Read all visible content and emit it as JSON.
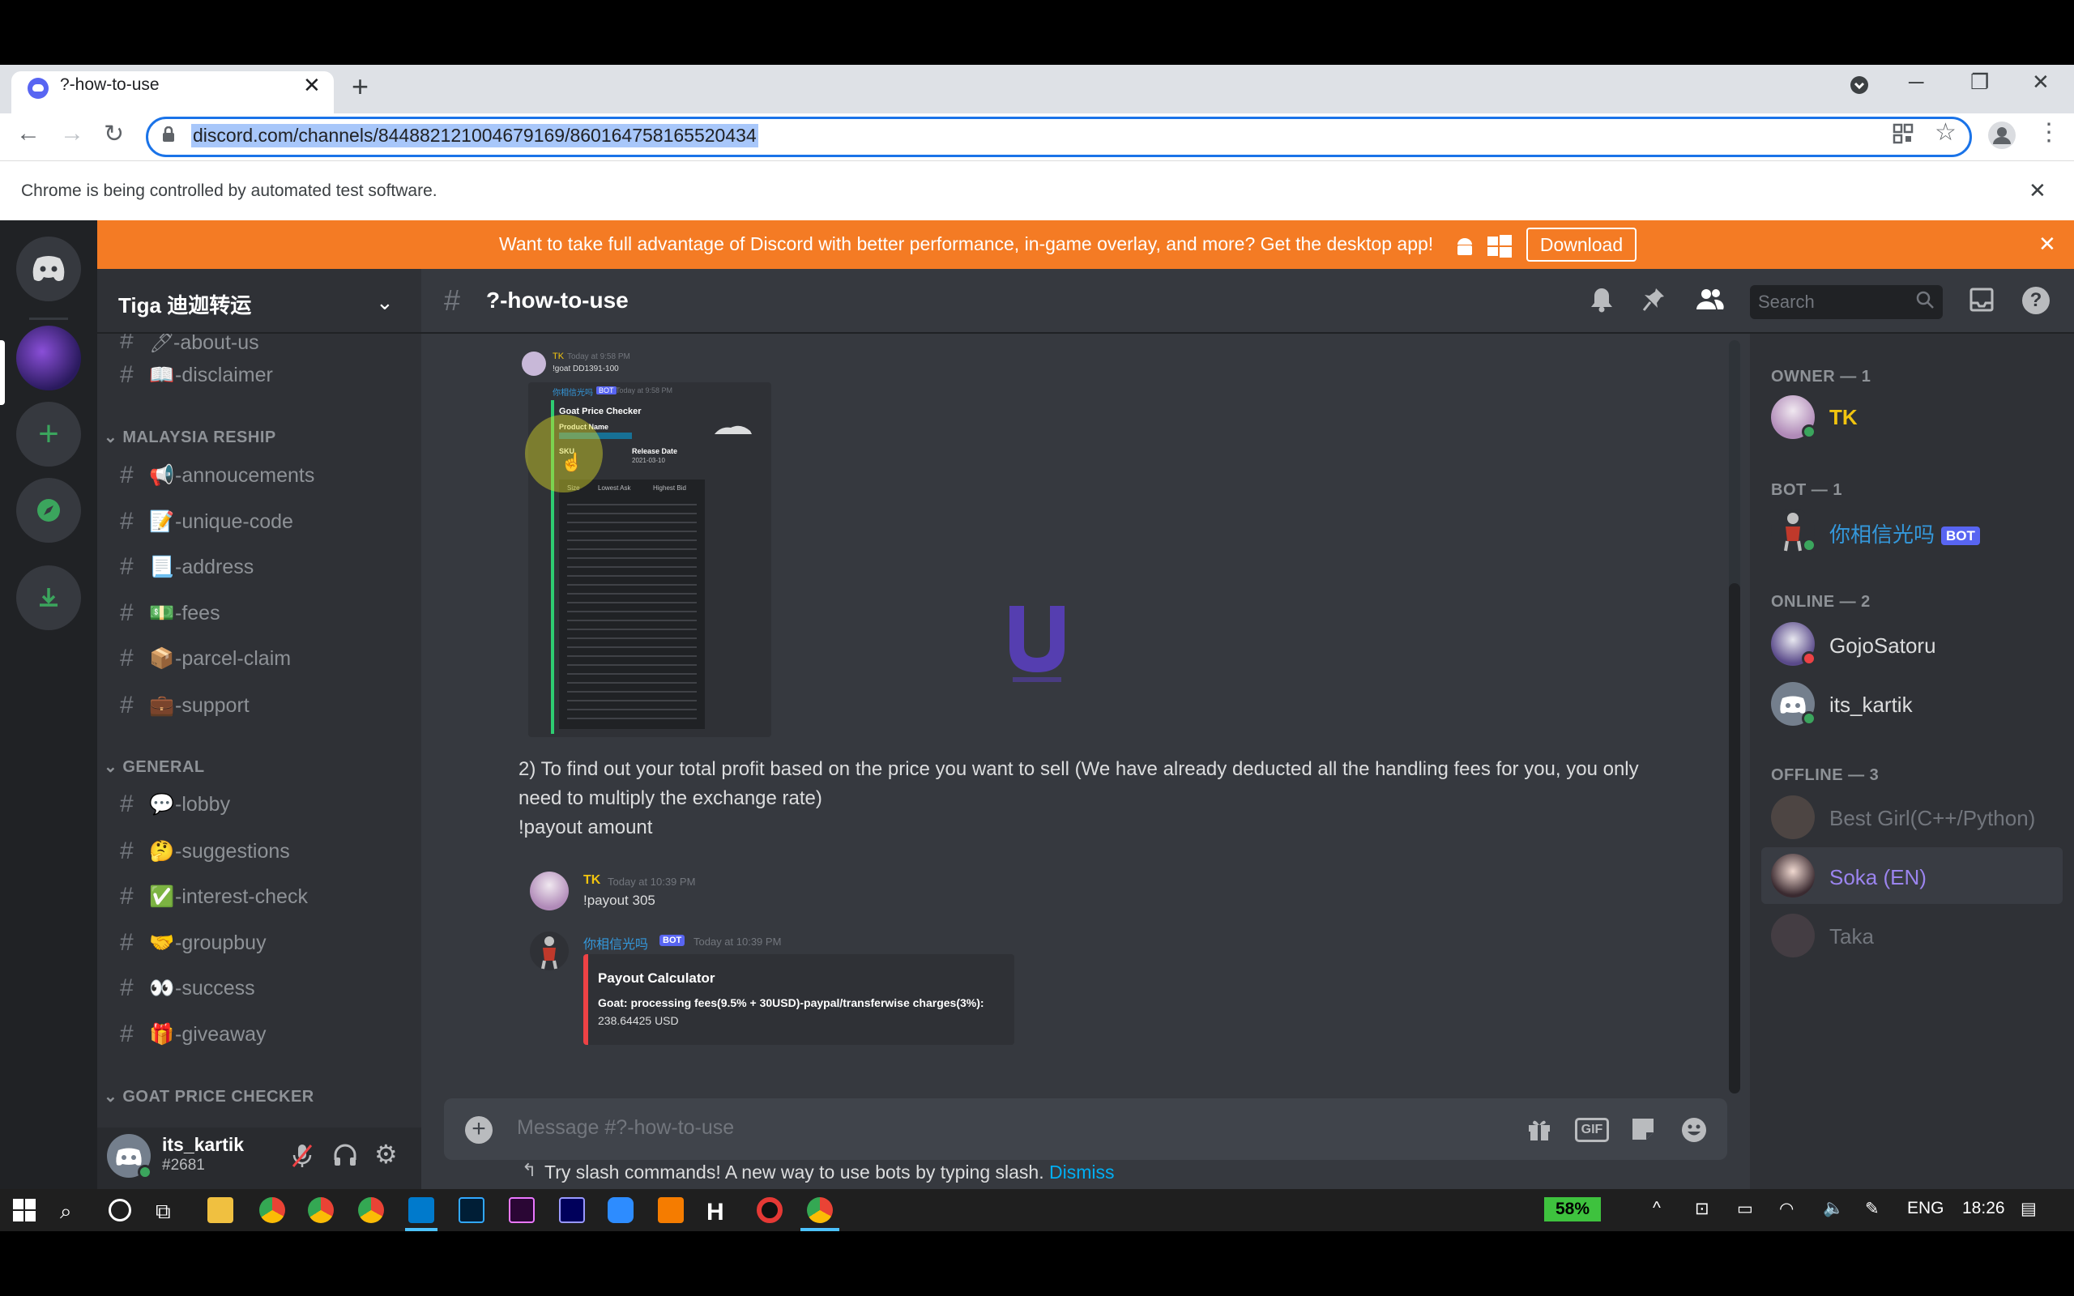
{
  "browser": {
    "tab_title": "?-how-to-use",
    "url": "discord.com/channels/844882121004679169/860164758165520434",
    "infobar_text": "Chrome is being controlled by automated test software."
  },
  "banner": {
    "text": "Want to take full advantage of Discord with better performance, in-game overlay, and more? Get the desktop app!",
    "download_label": "Download"
  },
  "server": {
    "name": "Tiga 迪迦转运",
    "partial_top_channel": "-about-us",
    "channels_top": [
      {
        "name": "-disclaimer",
        "emoji": "📖"
      }
    ],
    "categories": [
      {
        "name": "MALAYSIA RESHIP",
        "channels": [
          {
            "name": "-annoucements",
            "emoji": "📢"
          },
          {
            "name": "-unique-code",
            "emoji": "📝"
          },
          {
            "name": "-address",
            "emoji": "📃"
          },
          {
            "name": "-fees",
            "emoji": "💵"
          },
          {
            "name": "-parcel-claim",
            "emoji": "📦"
          },
          {
            "name": "-support",
            "emoji": "💼"
          }
        ]
      },
      {
        "name": "GENERAL",
        "channels": [
          {
            "name": "-lobby",
            "emoji": "💬"
          },
          {
            "name": "-suggestions",
            "emoji": "🤔"
          },
          {
            "name": "-interest-check",
            "emoji": "✅"
          },
          {
            "name": "-groupbuy",
            "emoji": "🤝"
          },
          {
            "name": "-success",
            "emoji": "👀"
          },
          {
            "name": "-giveaway",
            "emoji": "🎁"
          }
        ]
      },
      {
        "name": "GOAT PRICE CHECKER",
        "channels": []
      }
    ]
  },
  "user": {
    "name": "its_kartik",
    "tag": "#2681"
  },
  "channel": {
    "title": "?-how-to-use"
  },
  "search_placeholder": "Search",
  "messages": {
    "instruction_2": "2) To find out your total profit based on the price you want to sell (We have already deducted all the handling fees for you, you only need to multiply the exchange rate)",
    "command_hint": "!payout amount",
    "tk_author": "TK",
    "tk_time": "Today at 10:39 PM",
    "tk_text": "!payout 305",
    "bot_author": "你相信光吗",
    "bot_tag": "BOT",
    "bot_time": "Today at 10:39 PM",
    "embed_title": "Payout Calculator",
    "embed_field": "Goat: processing fees(9.5% + 30USD)-paypal/transferwise charges(3%):",
    "embed_value": "238.64425 USD",
    "screenshot": {
      "mini_author": "TK",
      "mini_time": "Today at 9:58 PM",
      "mini_cmd": "!goat DD1391-100",
      "mini_bot_time": "Today at 9:58 PM",
      "card_title": "Goat Price Checker",
      "product_name_label": "Product Name",
      "sku_label": "SKU",
      "release_label": "Release Date",
      "release_value": "2021-03-10",
      "columns": [
        "Size",
        "Lowest Ask",
        "Highest Bid"
      ]
    }
  },
  "composer": {
    "placeholder": "Message #?-how-to-use",
    "hint": "Try slash commands! A new way to use bots by typing slash.",
    "dismiss": "Dismiss"
  },
  "members": {
    "groups": [
      {
        "label": "OWNER — 1",
        "members": [
          {
            "name": "TK",
            "color": "#f1c40f"
          }
        ]
      },
      {
        "label": "BOT — 1",
        "members": [
          {
            "name": "你相信光吗",
            "color": "#3498db",
            "bot": "BOT"
          }
        ]
      },
      {
        "label": "ONLINE — 2",
        "members": [
          {
            "name": "GojoSatoru",
            "color": "#dcddde"
          },
          {
            "name": "its_kartik",
            "color": "#dcddde"
          }
        ]
      },
      {
        "label": "OFFLINE — 3",
        "members": [
          {
            "name": "Best Girl(C++/Python)",
            "color": "#72767d"
          },
          {
            "name": "Soka (EN)",
            "color": "#9b84ee"
          },
          {
            "name": "Taka",
            "color": "#72767d"
          }
        ]
      }
    ]
  },
  "taskbar": {
    "battery": "58%",
    "lang": "ENG",
    "time": "18:26"
  }
}
